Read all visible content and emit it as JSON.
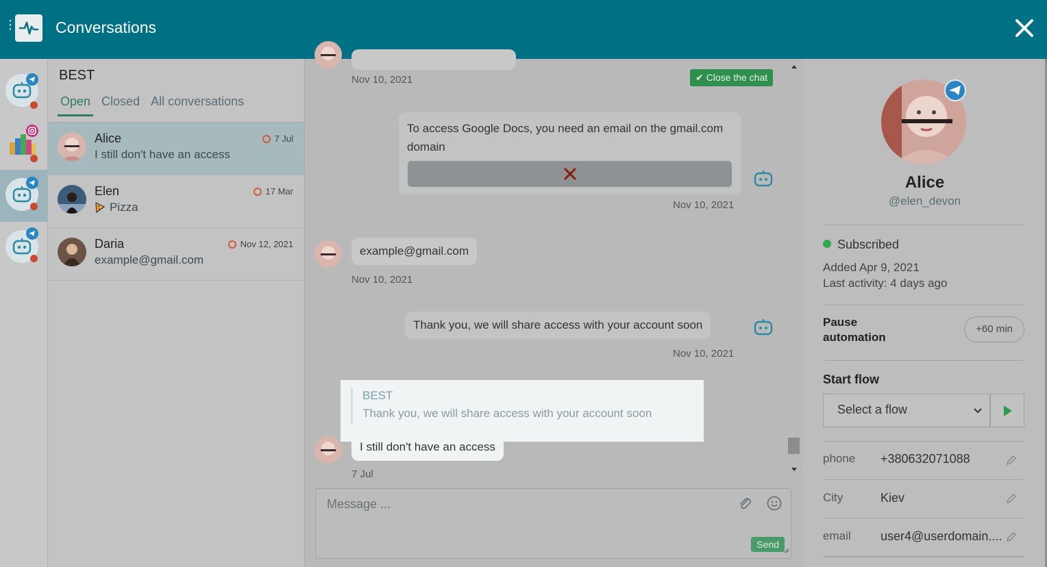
{
  "header": {
    "title": "Conversations"
  },
  "rail": {
    "channels": [
      {
        "badge": "telegram",
        "active": false
      },
      {
        "badge": "instagram",
        "active": false
      },
      {
        "badge": "telegram",
        "active": true
      },
      {
        "badge": "telegram",
        "active": false
      }
    ]
  },
  "list": {
    "account": "BEST",
    "tabs": [
      "Open",
      "Closed",
      "All conversations"
    ],
    "conversations": [
      {
        "name": "Alice",
        "last": "I still don't have an access",
        "date": "7 Jul"
      },
      {
        "name": "Elen",
        "last": "Pizza",
        "date": "17 Mar"
      },
      {
        "name": "Daria",
        "last": "example@gmail.com",
        "date": "Nov 12, 2021"
      }
    ]
  },
  "chat": {
    "close_label": "Close the chat",
    "top_date": "Nov 10, 2021",
    "msg1": "To access Google Docs, you need an email on the gmail.com domain",
    "msg1_date": "Nov 10, 2021",
    "msg2": "example@gmail.com",
    "msg2_date": "Nov 10, 2021",
    "msg3": "Thank you, we will share access with your account soon",
    "msg3_date": "Nov 10, 2021",
    "quote_name": "BEST",
    "quote_text": "Thank you, we will share access with your account soon",
    "msg4": "I still don't have an access",
    "msg4_date": "7 Jul",
    "placeholder": "Message ...",
    "send_label": "Send"
  },
  "profile": {
    "name": "Alice",
    "handle": "@elen_devon",
    "status": "Subscribed",
    "added": "Added Apr 9, 2021",
    "activity": "Last activity: 4 days ago",
    "pause_label": "Pause automation",
    "pause_button": "+60 min",
    "flow_label": "Start flow",
    "flow_select": "Select a flow",
    "fields": [
      {
        "key": "phone",
        "value": "+380632071088"
      },
      {
        "key": "City",
        "value": "Kiev"
      },
      {
        "key": "email",
        "value": "user4@userdomain...."
      }
    ]
  },
  "colors": {
    "header": "#007185",
    "accent": "#2f7d5e",
    "status_dot": "#2fa84f",
    "unread": "#d6573c"
  }
}
